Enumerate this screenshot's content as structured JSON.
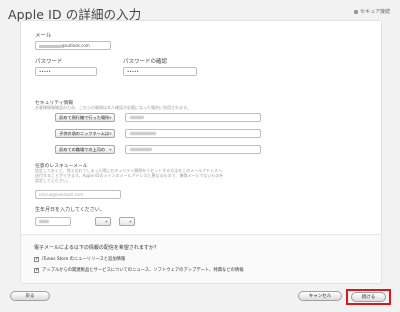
{
  "header": {
    "title": "Apple ID の詳細の入力",
    "secure_label": "セキュア接続"
  },
  "form": {
    "email_label": "メール",
    "email_value": "@outlook.com",
    "password_label": "パスワード",
    "password_value": "•••••",
    "password_confirm_label": "パスワードの確認",
    "password_confirm_value": "•••••",
    "security_heading": "セキュリティ情報",
    "security_note": "お客様情報確認のため、これらの質問は本人確認が必要になった場合に利用されます。",
    "questions": [
      {
        "label": "初めて飛行機で行った場所"
      },
      {
        "label": "子供の頃のニックネームは"
      },
      {
        "label": "初めての職場での上司の"
      }
    ],
    "rescue_heading": "任意のレスキューメール",
    "rescue_note_1": "設定しておくと、覚え忘れてしまった際にセキュリティ質問をリセットする方法をこのメールアドレスへ",
    "rescue_note_2": "送付することができます。Apple IDのメインのメールアドレスと異なるもので、携帯メールでないものを",
    "rescue_note_3": "設定してください。",
    "rescue_placeholder": "rescue@example.com",
    "birthday_label": "生年月日を入力してください。",
    "select_arrow": "÷"
  },
  "emails": {
    "question": "電子メールによる以下の情報の配信を希望されますか？",
    "opt1": "iTunes Store のニューリリースと追加情報",
    "opt2": "アップルからの関連製品とサービスについてのニュース、ソフトウェアのアップデート、特典などの情報"
  },
  "footer": {
    "back_label": "戻る",
    "cancel_label": "キャンセル",
    "next_label": "続ける"
  },
  "colors": {
    "highlight": "#d61a1a"
  }
}
